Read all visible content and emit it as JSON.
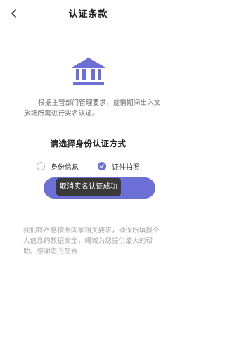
{
  "header": {
    "title": "认证条款",
    "back_icon": "chevron-left-icon"
  },
  "hero": {
    "icon": "bank-building-icon",
    "icon_color": "#6c70d6"
  },
  "intro": {
    "text": "根据主管部门管理要求，疫情期间出入文旅场所需进行实名认证。"
  },
  "method": {
    "title": "请选择身份认证方式",
    "options": [
      {
        "label": "身份信息",
        "selected": false
      },
      {
        "label": "证件拍照",
        "selected": true
      }
    ]
  },
  "primary_button": {
    "color": "#6c70d6"
  },
  "toast": {
    "text": "取消实名认证成功"
  },
  "notice": {
    "text": "我们将严格按照国家相关要求，确保所填报个人信息的数据安全，竭诚为您提供最大的帮助，感谢您的配合"
  }
}
